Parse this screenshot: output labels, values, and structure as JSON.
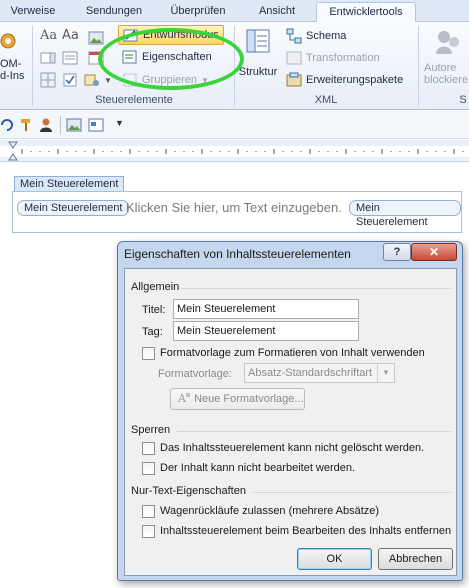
{
  "ribbon": {
    "tabs": [
      "Verweise",
      "Sendungen",
      "Überprüfen",
      "Ansicht",
      "Entwicklertools"
    ],
    "active_tab": "Entwicklertools",
    "addins_label_1": "OM-",
    "addins_label_2": "d-Ins",
    "controls_group": {
      "design_mode": "Entwurfsmodus",
      "properties": "Eigenschaften",
      "grouping": "Gruppieren",
      "label": "Steuerelemente"
    },
    "xml_group": {
      "structure": "Struktur",
      "schema": "Schema",
      "transformation": "Transformation",
      "expansion_packs": "Erweiterungspakete",
      "label": "XML"
    },
    "protect_group": {
      "label_1": "Autore",
      "label_2": "blockiere",
      "label_3": "S"
    }
  },
  "document": {
    "control_title": "Mein Steuerelement",
    "control_start_tag": "Mein Steuerelement",
    "control_end_tag": "Mein Steuerelement",
    "placeholder": "Klicken Sie hier, um Text einzugeben."
  },
  "dialog": {
    "title": "Eigenschaften von Inhaltssteuerelementen",
    "help": "?",
    "close": "✕",
    "general_section": "Allgemein",
    "title_label": "Titel:",
    "title_value": "Mein Steuerelement",
    "tag_label": "Tag:",
    "tag_value": "Mein Steuerelement",
    "use_style_label": "Formatvorlage zum Formatieren von Inhalt verwenden",
    "style_label": "Formatvorlage:",
    "style_value": "Absatz-Standardschriftart",
    "new_style_button": "Neue Formatvorlage...",
    "locking_section": "Sperren",
    "cannot_delete": "Das Inhaltssteuerelement kann nicht gelöscht werden.",
    "cannot_edit": "Der Inhalt kann nicht bearbeitet werden.",
    "plain_text_section": "Nur-Text-Eigenschaften",
    "allow_returns": "Wagenrückläufe zulassen (mehrere Absätze)",
    "remove_when_edited": "Inhaltssteuerelement beim Bearbeiten des Inhalts entfernen",
    "ok": "OK",
    "cancel": "Abbrechen"
  },
  "colors": {
    "highlight": "#39d43a",
    "dialog_frame": "#c4d7ee",
    "close_button": "#c64a34"
  }
}
